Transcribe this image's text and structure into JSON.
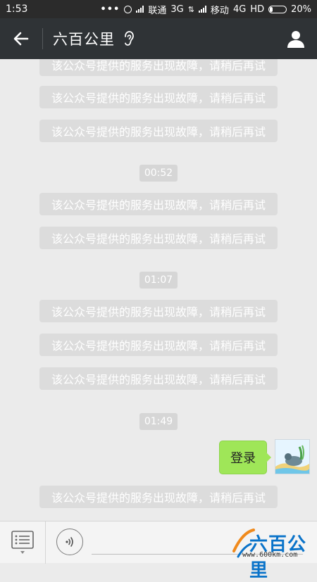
{
  "status_bar": {
    "time": "1:53",
    "dots": "•••",
    "carrier1": "联通",
    "net1": "3G",
    "carrier2": "移动",
    "net2": "4G",
    "hd": "HD",
    "battery": "20%"
  },
  "header": {
    "title": "六百公里",
    "back_icon": "arrow-left-icon",
    "ear_icon": "ear-icon",
    "profile_icon": "person-icon"
  },
  "messages": [
    {
      "type": "system",
      "text": "该公众号提供的服务出现故障，请稍后再试"
    },
    {
      "type": "system",
      "text": "该公众号提供的服务出现故障，请稍后再试"
    },
    {
      "type": "system",
      "text": "该公众号提供的服务出现故障，请稍后再试"
    },
    {
      "type": "timestamp",
      "text": "00:52"
    },
    {
      "type": "system",
      "text": "该公众号提供的服务出现故障，请稍后再试"
    },
    {
      "type": "system",
      "text": "该公众号提供的服务出现故障，请稍后再试"
    },
    {
      "type": "timestamp",
      "text": "01:07"
    },
    {
      "type": "system",
      "text": "该公众号提供的服务出现故障，请稍后再试"
    },
    {
      "type": "system",
      "text": "该公众号提供的服务出现故障，请稍后再试"
    },
    {
      "type": "system",
      "text": "该公众号提供的服务出现故障，请稍后再试"
    },
    {
      "type": "timestamp",
      "text": "01:49"
    },
    {
      "type": "outgoing",
      "text": "登录"
    },
    {
      "type": "system",
      "text": "该公众号提供的服务出现故障，请稍后再试"
    }
  ],
  "bottom_bar": {
    "menu_icon": "menu-list-icon",
    "voice_icon": "voice-icon",
    "watermark_text": "六百公里",
    "watermark_url": "www.600km.com"
  },
  "colors": {
    "header_bg": "#2f3336",
    "bubble_green": "#9fe658",
    "system_bubble": "#dcdcdc"
  }
}
